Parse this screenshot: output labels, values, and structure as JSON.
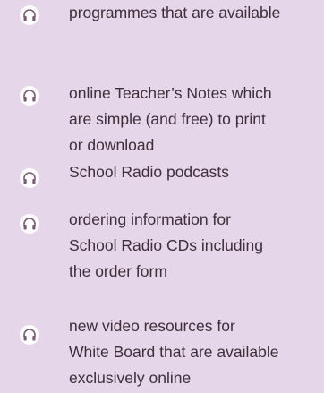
{
  "items": [
    {
      "icon": "headphones-icon",
      "lines": [
        "programmes that are available"
      ]
    },
    {
      "icon": "headphones-icon",
      "lines": [
        "online Teacher’s Notes which",
        "are simple (and free) to print",
        "or download"
      ]
    },
    {
      "icon": "headphones-icon",
      "lines": [
        "School Radio podcasts"
      ]
    },
    {
      "icon": "headphones-icon",
      "lines": [
        "ordering information for",
        "School Radio CDs including",
        "the order form"
      ]
    },
    {
      "icon": "headphones-icon",
      "lines": [
        "new video resources for",
        "White Board that are available",
        "exclusively online"
      ]
    }
  ],
  "colors": {
    "background": "#e6d6e9",
    "text": "#3d2e3a",
    "icon_fill": "#ffffff",
    "icon_stroke": "#7a5a76"
  }
}
